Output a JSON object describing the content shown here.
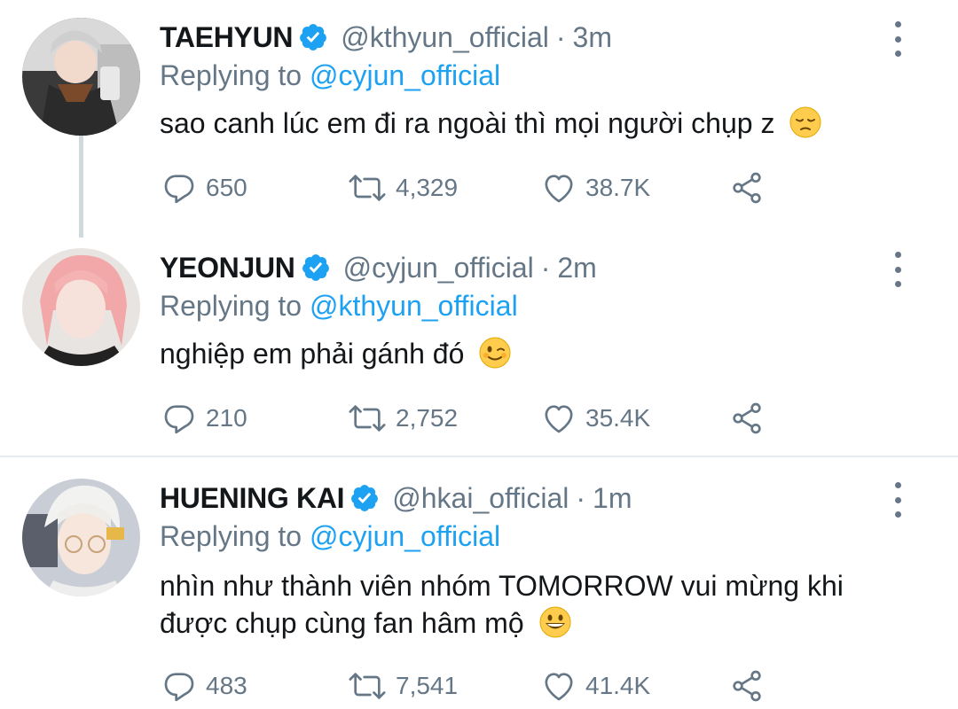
{
  "tweets": [
    {
      "name": "TAEHYUN",
      "handle": "@kthyun_official",
      "separator": "·",
      "time": "3m",
      "replying_prefix": "Replying to",
      "replying_to": "@cyjun_official",
      "text": "sao canh lúc em đi ra ngoài thì mọi người chụp z",
      "emoji": "pensive-face-emoji",
      "replies": "650",
      "retweets": "4,329",
      "likes": "38.7K"
    },
    {
      "name": "YEONJUN",
      "handle": "@cyjun_official",
      "separator": "·",
      "time": "2m",
      "replying_prefix": "Replying to",
      "replying_to": "@kthyun_official",
      "text": "nghiệp em phải gánh đó",
      "emoji": "winking-face-emoji",
      "replies": "210",
      "retweets": "2,752",
      "likes": "35.4K"
    },
    {
      "name": "HUENING KAI",
      "handle": "@hkai_official",
      "separator": "·",
      "time": "1m",
      "replying_prefix": "Replying to",
      "replying_to": "@cyjun_official",
      "text_line1": "nhìn như thành viên nhóm TOMORROW vui mừng khi",
      "text_line2": "được chụp cùng fan hâm mộ",
      "emoji": "grinning-face-emoji",
      "replies": "483",
      "retweets": "7,541",
      "likes": "41.4K"
    }
  ],
  "colors": {
    "accent": "#1da1f2",
    "secondary_text": "#657786",
    "primary_text": "#14171a",
    "thread_line": "#cfd9de",
    "divider": "#e6ecf0"
  }
}
